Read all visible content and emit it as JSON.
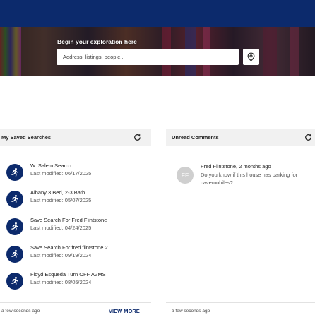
{
  "hero": {
    "label": "Begin your exploration here",
    "search_placeholder": "Address, listings, people..."
  },
  "saved_searches": {
    "title": "My Saved Searches",
    "items": [
      {
        "name": "W. Salem Search",
        "modified": "Last modified: 06/17/2025"
      },
      {
        "name": "Albany 3 Bed, 2-3 Bath",
        "modified": "Last modified: 05/07/2025"
      },
      {
        "name": "Save Search For Fred Flintstone",
        "modified": "Last modified: 04/24/2025"
      },
      {
        "name": "Save Search For fred flintstone 2",
        "modified": "Last modified: 09/19/2024"
      },
      {
        "name": "Floyd Esqueda Turn OFF AVMS",
        "modified": "Last modified: 08/05/2024"
      }
    ],
    "updated": "a few seconds ago",
    "view_more": "VIEW MORE"
  },
  "unread_comments": {
    "title": "Unread Comments",
    "items": [
      {
        "initials": "FF",
        "author": "Fred Flintstone, 2 months ago",
        "text": "Do you know if this house has parking for cavemobiles?"
      }
    ],
    "updated": "a few seconds ago"
  },
  "colors": {
    "brand": "#0c2a6c",
    "panel_header": "#f1f1f1",
    "avatar_gray": "#cfcfcf"
  },
  "icons": [
    "map-pin-icon",
    "refresh-icon",
    "saved-search-person-icon"
  ]
}
